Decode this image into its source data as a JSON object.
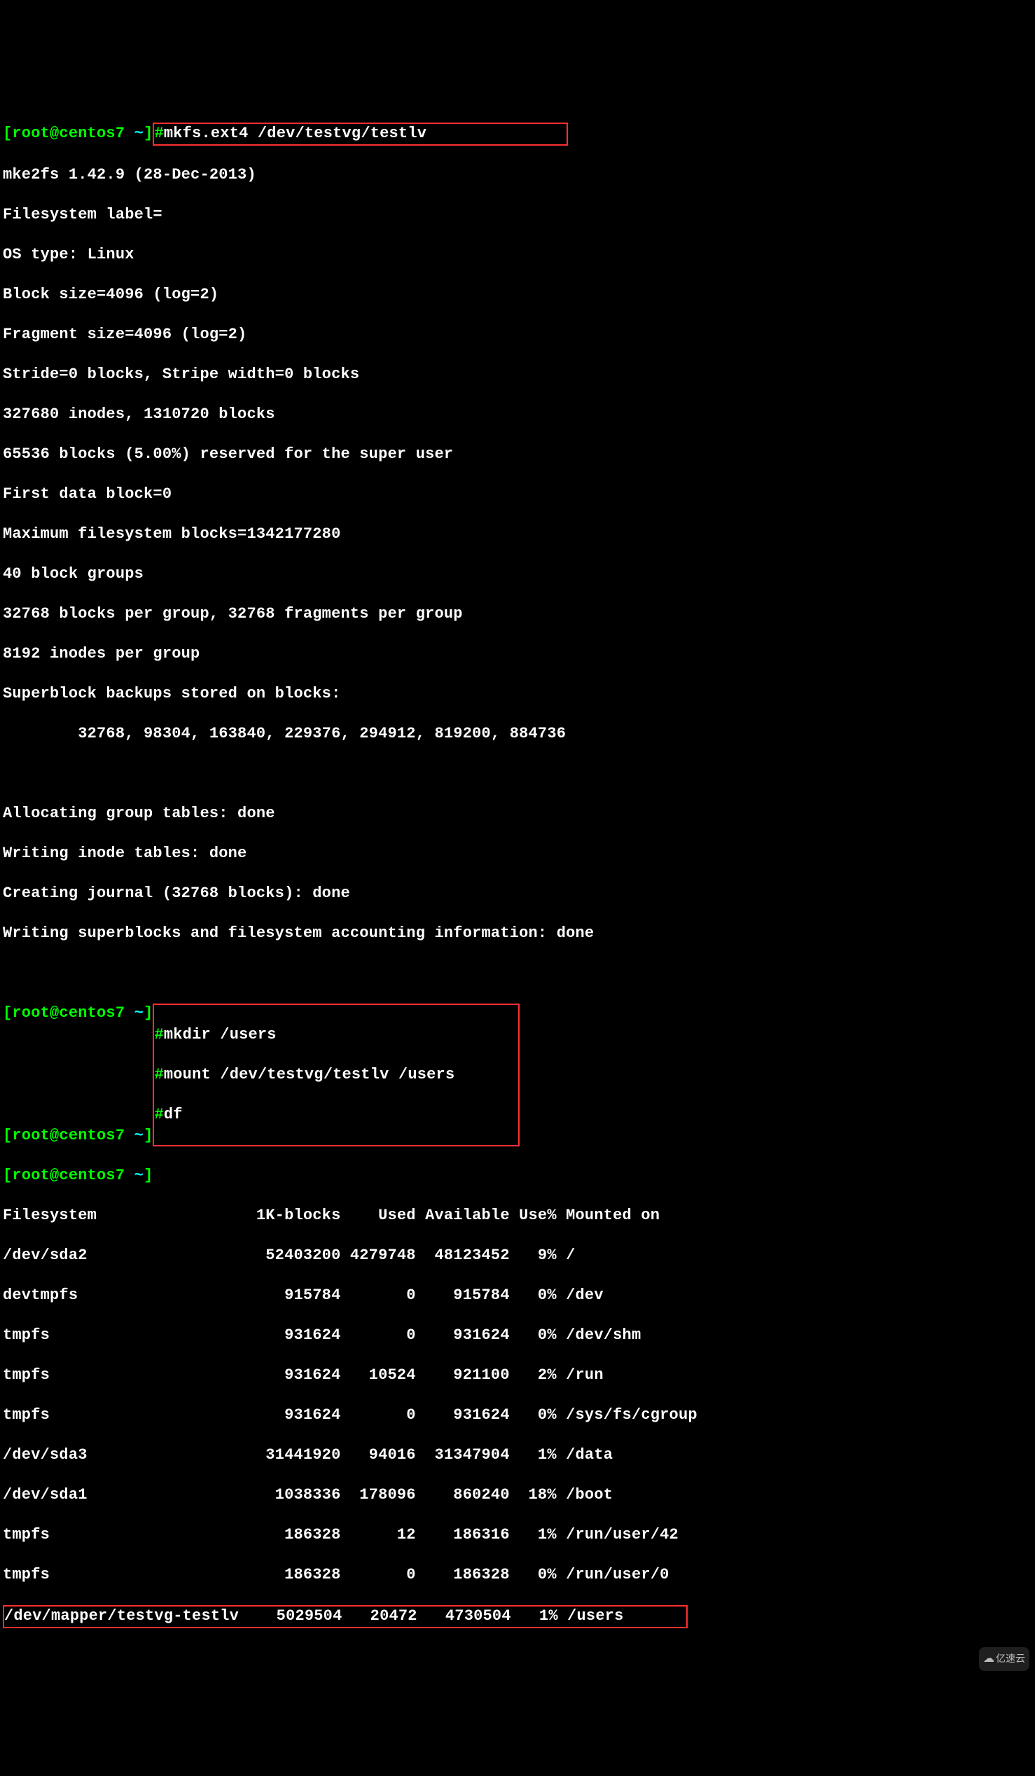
{
  "prompt_user": "root",
  "prompt_host": "centos7",
  "prompt_dir": "~",
  "commands": {
    "mkfs": "mkfs.ext4 /dev/testvg/testlv",
    "mkdir": "mkdir /users",
    "mount": "mount /dev/testvg/testlv /users",
    "df": "df"
  },
  "mkfs_output": {
    "line1": "mke2fs 1.42.9 (28-Dec-2013)",
    "line2": "Filesystem label=",
    "line3": "OS type: Linux",
    "line4": "Block size=4096 (log=2)",
    "line5": "Fragment size=4096 (log=2)",
    "line6": "Stride=0 blocks, Stripe width=0 blocks",
    "line7": "327680 inodes, 1310720 blocks",
    "line8": "65536 blocks (5.00%) reserved for the super user",
    "line9": "First data block=0",
    "line10": "Maximum filesystem blocks=1342177280",
    "line11": "40 block groups",
    "line12": "32768 blocks per group, 32768 fragments per group",
    "line13": "8192 inodes per group",
    "line14": "Superblock backups stored on blocks:",
    "line15": "        32768, 98304, 163840, 229376, 294912, 819200, 884736",
    "line17": "Allocating group tables: done",
    "line18": "Writing inode tables: done",
    "line19": "Creating journal (32768 blocks): done",
    "line20": "Writing superblocks and filesystem accounting information: done"
  },
  "df_output": {
    "header": "Filesystem                 1K-blocks    Used Available Use% Mounted on",
    "rows": [
      "/dev/sda2                   52403200 4279748  48123452   9% /",
      "devtmpfs                      915784       0    915784   0% /dev",
      "tmpfs                         931624       0    931624   0% /dev/shm",
      "tmpfs                         931624   10524    921100   2% /run",
      "tmpfs                         931624       0    931624   0% /sys/fs/cgroup",
      "/dev/sda3                   31441920   94016  31347904   1% /data",
      "/dev/sda1                    1038336  178096    860240  18% /boot",
      "tmpfs                         186328      12    186316   1% /run/user/42",
      "tmpfs                         186328       0    186328   0% /run/user/0",
      "/dev/mapper/testvg-testlv    5029504   20472   4730504   1% /users"
    ]
  },
  "prompt_open": "[",
  "prompt_at": "@",
  "prompt_space": " ",
  "prompt_close": "]",
  "prompt_hash": "#",
  "watermark": "亿速云"
}
